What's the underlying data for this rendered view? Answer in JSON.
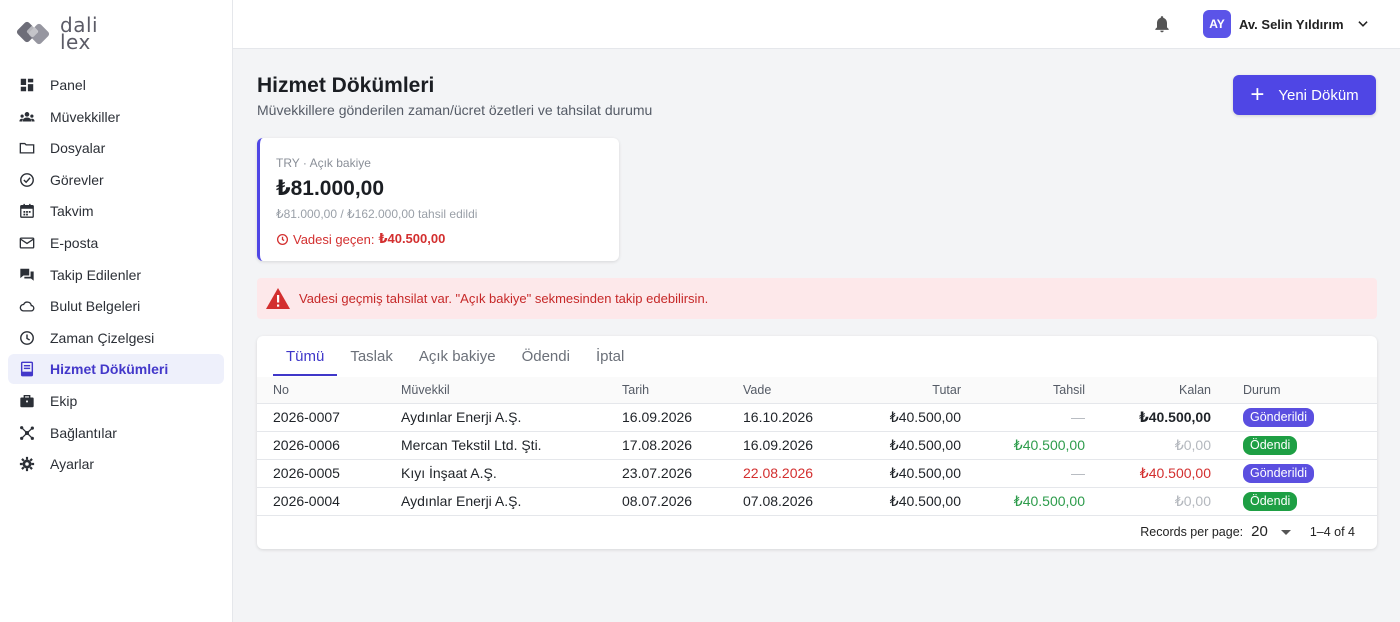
{
  "brand": {
    "line1": "dali",
    "line2": "lex",
    "accent": "#4f46e5"
  },
  "sidebar": {
    "items": [
      {
        "label": "Panel",
        "icon": "dashboard-icon",
        "active": false
      },
      {
        "label": "Müvekkiller",
        "icon": "clients-icon",
        "active": false
      },
      {
        "label": "Dosyalar",
        "icon": "folder-icon",
        "active": false
      },
      {
        "label": "Görevler",
        "icon": "check-circle-icon",
        "active": false
      },
      {
        "label": "Takvim",
        "icon": "calendar-icon",
        "active": false
      },
      {
        "label": "E-posta",
        "icon": "mail-icon",
        "active": false
      },
      {
        "label": "Takip Edilenler",
        "icon": "forum-icon",
        "active": false
      },
      {
        "label": "Bulut Belgeleri",
        "icon": "cloud-icon",
        "active": false
      },
      {
        "label": "Zaman Çizelgesi",
        "icon": "clock-icon",
        "active": false
      },
      {
        "label": "Hizmet Dökümleri",
        "icon": "receipt-icon",
        "active": true
      },
      {
        "label": "Ekip",
        "icon": "briefcase-icon",
        "active": false
      },
      {
        "label": "Bağlantılar",
        "icon": "hub-icon",
        "active": false
      },
      {
        "label": "Ayarlar",
        "icon": "gear-icon",
        "active": false
      }
    ]
  },
  "topbar": {
    "user_initials": "AY",
    "user_name": "Av. Selin Yıldırım"
  },
  "page": {
    "title": "Hizmet Dökümleri",
    "subtitle": "Müvekkillere gönderilen zaman/ücret özetleri ve tahsilat durumu",
    "new_button": "Yeni Döküm"
  },
  "balance": {
    "label": "TRY · Açık bakiye",
    "amount": "₺81.000,00",
    "collected": "₺81.000,00 / ₺162.000,00 tahsil edildi",
    "overdue_label": "Vadesi geçen:",
    "overdue_amount": "₺40.500,00"
  },
  "alert": {
    "text": "Vadesi geçmiş tahsilat var. \"Açık bakiye\" sekmesinden takip edebilirsin."
  },
  "tabs": [
    {
      "label": "Tümü",
      "active": true
    },
    {
      "label": "Taslak",
      "active": false
    },
    {
      "label": "Açık bakiye",
      "active": false
    },
    {
      "label": "Ödendi",
      "active": false
    },
    {
      "label": "İptal",
      "active": false
    }
  ],
  "table": {
    "headers": {
      "no": "No",
      "client": "Müvekkil",
      "date": "Tarih",
      "due": "Vade",
      "amount": "Tutar",
      "collected": "Tahsil",
      "remaining": "Kalan",
      "status": "Durum"
    },
    "rows": [
      {
        "no": "2026-0007",
        "client": "Aydınlar Enerji A.Ş.",
        "date": "16.09.2026",
        "due": "16.10.2026",
        "due_overdue": false,
        "amount": "₺40.500,00",
        "collected": "—",
        "collected_kind": "none",
        "remaining": "₺40.500,00",
        "remaining_kind": "open",
        "status": "Gönderildi",
        "status_kind": "sent"
      },
      {
        "no": "2026-0006",
        "client": "Mercan Tekstil Ltd. Şti.",
        "date": "17.08.2026",
        "due": "16.09.2026",
        "due_overdue": false,
        "amount": "₺40.500,00",
        "collected": "₺40.500,00",
        "collected_kind": "paid",
        "remaining": "₺0,00",
        "remaining_kind": "zero",
        "status": "Ödendi",
        "status_kind": "paid"
      },
      {
        "no": "2026-0005",
        "client": "Kıyı İnşaat A.Ş.",
        "date": "23.07.2026",
        "due": "22.08.2026",
        "due_overdue": true,
        "amount": "₺40.500,00",
        "collected": "—",
        "collected_kind": "none",
        "remaining": "₺40.500,00",
        "remaining_kind": "overdue",
        "status": "Gönderildi",
        "status_kind": "sent"
      },
      {
        "no": "2026-0004",
        "client": "Aydınlar Enerji A.Ş.",
        "date": "08.07.2026",
        "due": "07.08.2026",
        "due_overdue": false,
        "amount": "₺40.500,00",
        "collected": "₺40.500,00",
        "collected_kind": "paid",
        "remaining": "₺0,00",
        "remaining_kind": "zero",
        "status": "Ödendi",
        "status_kind": "paid"
      }
    ]
  },
  "pager": {
    "rpp_label": "Records per page:",
    "rpp_value": "20",
    "range": "1–4 of 4"
  }
}
